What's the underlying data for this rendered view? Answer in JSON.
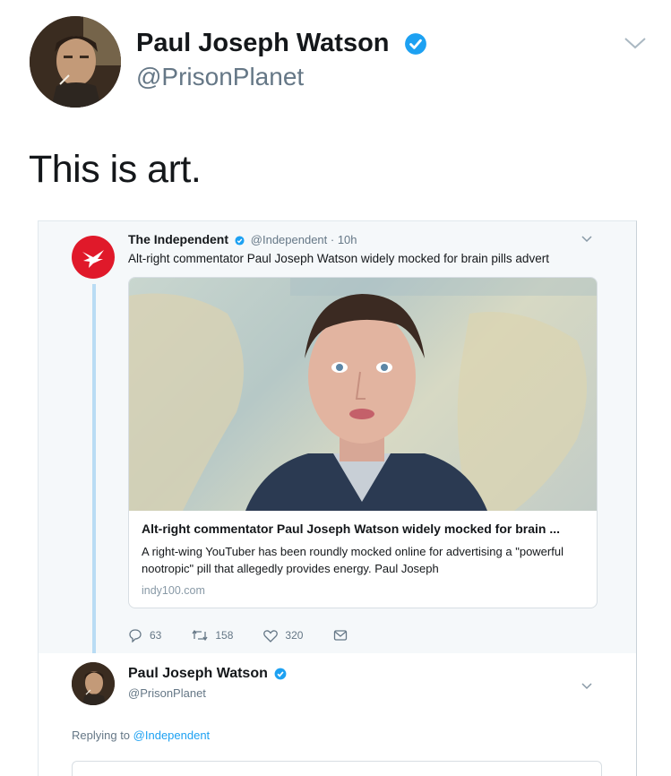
{
  "tweet": {
    "author_name": "Paul Joseph Watson",
    "handle": "@PrisonPlanet",
    "text": "This is art."
  },
  "embedded": {
    "source_name": "The Independent",
    "source_meta": "@Independent · 10h",
    "source_text": "Alt-right commentator Paul Joseph Watson widely mocked for brain pills advert",
    "card": {
      "title": "Alt-right commentator Paul Joseph Watson widely mocked for brain ...",
      "description": "A right-wing YouTuber has been roundly mocked online for advertising a \"powerful nootropic\" pill that allegedly provides energy. Paul Joseph",
      "domain": "indy100.com"
    },
    "actions": {
      "replies": "63",
      "retweets": "158",
      "likes": "320"
    },
    "reply": {
      "author_name": "Paul Joseph Watson",
      "handle": "@PrisonPlanet",
      "replying_prefix": "Replying to",
      "replying_to": "@Independent"
    }
  },
  "icons": {
    "verified": "verified-badge-icon",
    "caret": "chevron-down-icon",
    "reply": "reply-icon",
    "retweet": "retweet-icon",
    "like": "heart-icon",
    "dm": "envelope-icon",
    "eagle": "independent-eagle-logo"
  },
  "colors": {
    "accent": "#1da1f2",
    "independent_red": "#e0192a",
    "secondary_text": "#657786"
  }
}
